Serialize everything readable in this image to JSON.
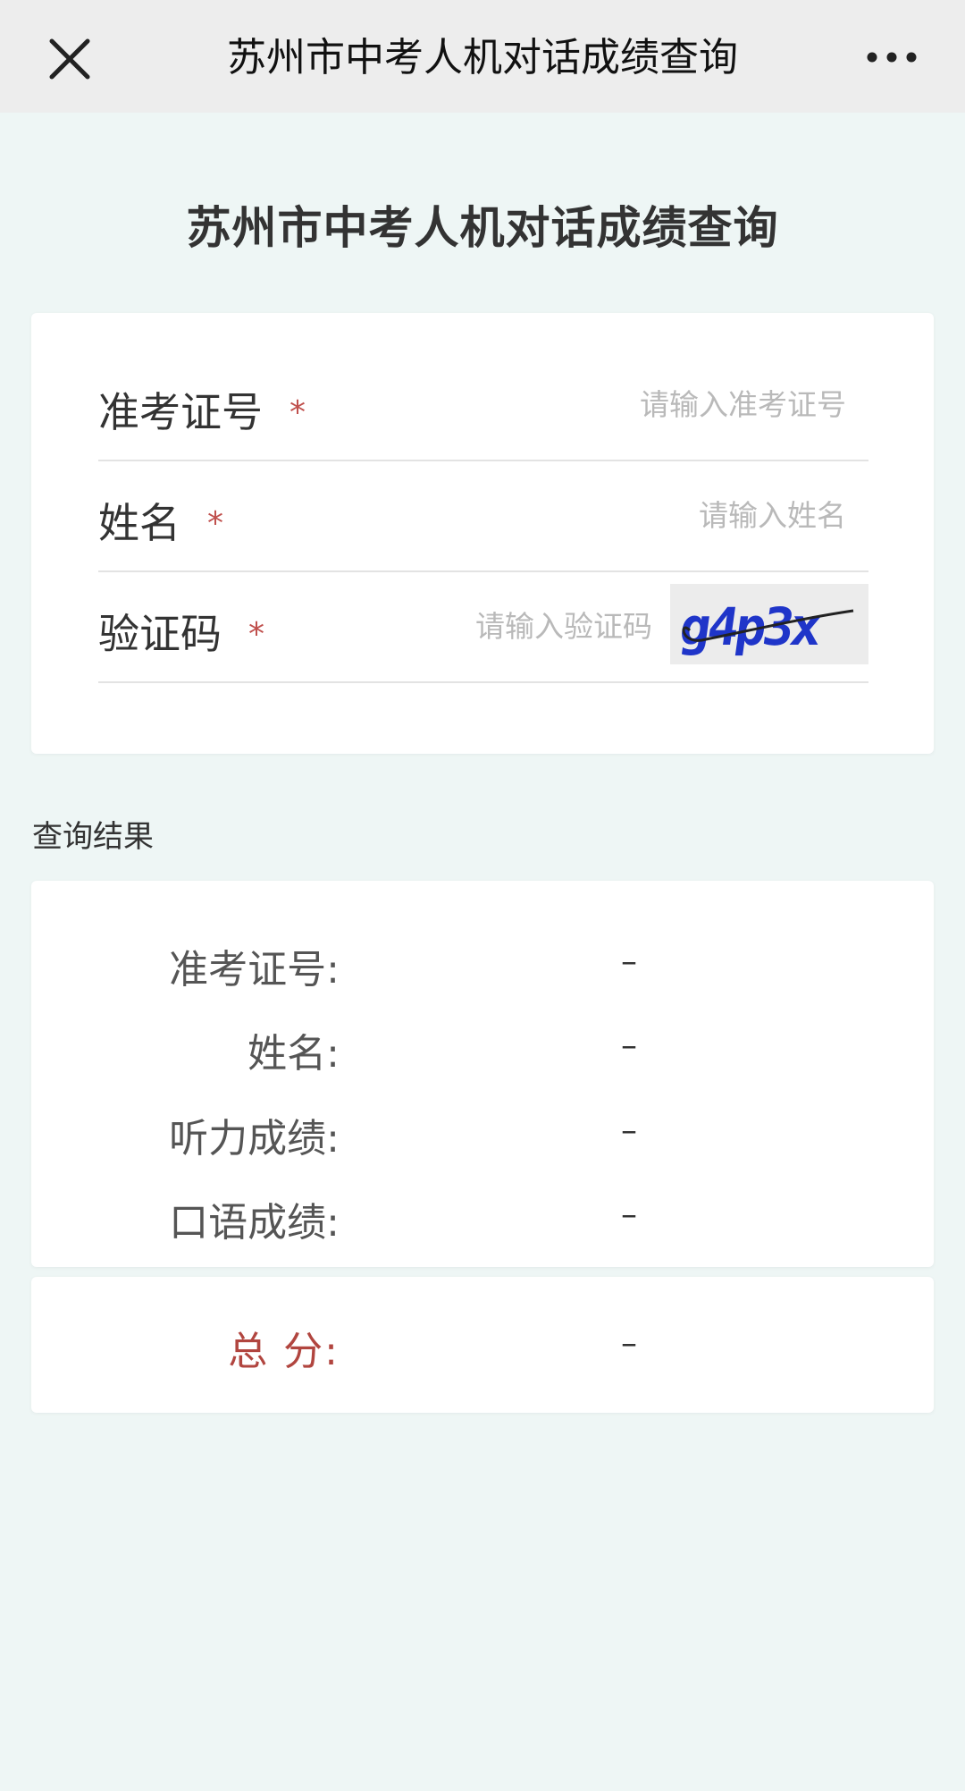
{
  "topbar": {
    "title": "苏州市中考人机对话成绩查询",
    "close_icon": "close-icon",
    "more_icon": "more-dots-icon"
  },
  "page": {
    "title": "苏州市中考人机对话成绩查询"
  },
  "form": {
    "fields": [
      {
        "label": "准考证号",
        "required": "*",
        "placeholder": "请输入准考证号",
        "value": ""
      },
      {
        "label": "姓名",
        "required": "*",
        "placeholder": "请输入姓名",
        "value": ""
      },
      {
        "label": "验证码",
        "required": "*",
        "placeholder": "请输入验证码",
        "value": ""
      }
    ],
    "captcha_text": "g4p3x"
  },
  "results": {
    "section_title": "查询结果",
    "rows": [
      {
        "label": "准考证号:",
        "value": "–"
      },
      {
        "label": "姓名:",
        "value": "–"
      },
      {
        "label": "听力成绩:",
        "value": "–"
      },
      {
        "label": "口语成绩:",
        "value": "–"
      }
    ],
    "total": {
      "label": "总 分:",
      "value": "–"
    }
  },
  "colors": {
    "accent_required": "#c0504d",
    "total_label": "#b1453f",
    "page_background": "#eef6f5",
    "captcha_text": "#1f35c9"
  }
}
